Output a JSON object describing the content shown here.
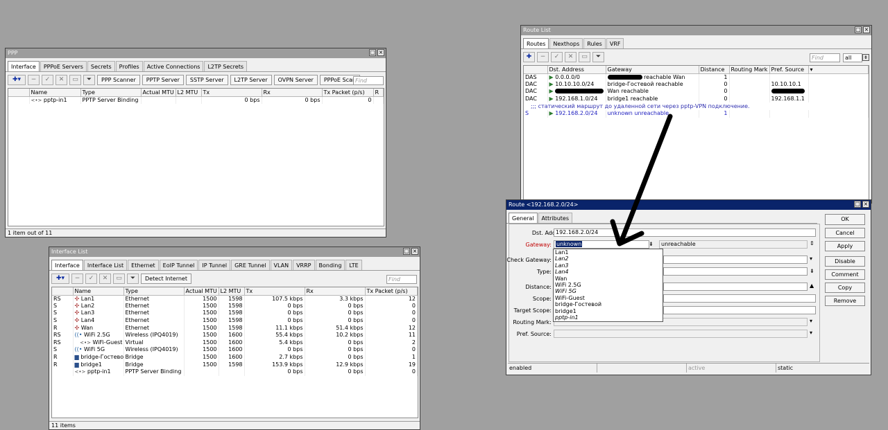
{
  "ppp": {
    "title": "PPP",
    "tabs": [
      "Interface",
      "PPPoE Servers",
      "Secrets",
      "Profiles",
      "Active Connections",
      "L2TP Secrets"
    ],
    "buttons": [
      "PPP Scanner",
      "PPTP Server",
      "SSTP Server",
      "L2TP Server",
      "OVPN Server",
      "PPPoE Scan"
    ],
    "find": "Find",
    "columns": [
      "Name",
      "Type",
      "Actual MTU",
      "L2 MTU",
      "Tx",
      "Rx",
      "Tx Packet (p/s)",
      "R"
    ],
    "rows": [
      {
        "flag": "",
        "name": "pptp-in1",
        "type": "PPTP Server Binding",
        "mtu": "",
        "l2mtu": "",
        "tx": "0 bps",
        "rx": "0 bps",
        "txp": "0"
      }
    ],
    "status": "1 item out of 11"
  },
  "iflist": {
    "title": "Interface List",
    "tabs": [
      "Interface",
      "Interface List",
      "Ethernet",
      "EoIP Tunnel",
      "IP Tunnel",
      "GRE Tunnel",
      "VLAN",
      "VRRP",
      "Bonding",
      "LTE"
    ],
    "detect_button": "Detect Internet",
    "find": "Find",
    "columns": [
      "Name",
      "Type",
      "Actual MTU",
      "L2 MTU",
      "Tx",
      "Rx",
      "Tx Packet (p/s)"
    ],
    "rows": [
      {
        "flag": "RS",
        "icon": "eth",
        "name": "Lan1",
        "type": "Ethernet",
        "mtu": "1500",
        "l2mtu": "1598",
        "tx": "107.5 kbps",
        "rx": "3.3 kbps",
        "txp": "12"
      },
      {
        "flag": "S",
        "icon": "eth",
        "name": "Lan2",
        "type": "Ethernet",
        "mtu": "1500",
        "l2mtu": "1598",
        "tx": "0 bps",
        "rx": "0 bps",
        "txp": "0"
      },
      {
        "flag": "S",
        "icon": "eth",
        "name": "Lan3",
        "type": "Ethernet",
        "mtu": "1500",
        "l2mtu": "1598",
        "tx": "0 bps",
        "rx": "0 bps",
        "txp": "0"
      },
      {
        "flag": "S",
        "icon": "eth",
        "name": "Lan4",
        "type": "Ethernet",
        "mtu": "1500",
        "l2mtu": "1598",
        "tx": "0 bps",
        "rx": "0 bps",
        "txp": "0"
      },
      {
        "flag": "R",
        "icon": "eth",
        "name": "Wan",
        "type": "Ethernet",
        "mtu": "1500",
        "l2mtu": "1598",
        "tx": "11.1 kbps",
        "rx": "51.4 kbps",
        "txp": "12"
      },
      {
        "flag": "RS",
        "icon": "wifi",
        "name": "WiFi 2.5G",
        "type": "Wireless (IPQ4019)",
        "mtu": "1500",
        "l2mtu": "1600",
        "tx": "55.4 kbps",
        "rx": "10.2 kbps",
        "txp": "11"
      },
      {
        "flag": "RS",
        "icon": "if",
        "name": "WiFi-Guest",
        "type": "Virtual",
        "mtu": "1500",
        "l2mtu": "1600",
        "tx": "5.4 kbps",
        "rx": "0 bps",
        "txp": "2",
        "indent": true
      },
      {
        "flag": "S",
        "icon": "wifi",
        "name": "WiFi 5G",
        "type": "Wireless (IPQ4019)",
        "mtu": "1500",
        "l2mtu": "1600",
        "tx": "0 bps",
        "rx": "0 bps",
        "txp": "0"
      },
      {
        "flag": "R",
        "icon": "br",
        "name": "bridge-Гостевой",
        "type": "Bridge",
        "mtu": "1500",
        "l2mtu": "1600",
        "tx": "2.7 kbps",
        "rx": "0 bps",
        "txp": "1"
      },
      {
        "flag": "R",
        "icon": "br",
        "name": "bridge1",
        "type": "Bridge",
        "mtu": "1500",
        "l2mtu": "1598",
        "tx": "153.9 kbps",
        "rx": "12.9 kbps",
        "txp": "19"
      },
      {
        "flag": "",
        "icon": "if",
        "name": "pptp-in1",
        "type": "PPTP Server Binding",
        "mtu": "",
        "l2mtu": "",
        "tx": "0 bps",
        "rx": "0 bps",
        "txp": "0"
      }
    ],
    "status": "11 items"
  },
  "routes": {
    "title": "Route List",
    "tabs": [
      "Routes",
      "Nexthops",
      "Rules",
      "VRF"
    ],
    "find": "Find",
    "filter": "all",
    "columns": [
      "Dst. Address",
      "Gateway",
      "Distance",
      "Routing Mark",
      "Pref. Source"
    ],
    "rows": [
      {
        "flag": "DAS",
        "dst": "0.0.0.0/0",
        "gw": "reachable Wan",
        "dist": "1",
        "mark": "",
        "pref": "",
        "gw_redact": true
      },
      {
        "flag": "DAC",
        "dst": "10.10.10.0/24",
        "gw": "bridge-Гостевой reachable",
        "dist": "0",
        "mark": "",
        "pref": "10.10.10.1"
      },
      {
        "flag": "DAC",
        "dst": "",
        "gw": "Wan reachable",
        "dist": "0",
        "mark": "",
        "pref": "",
        "dst_redact": true,
        "pref_redact": true
      },
      {
        "flag": "DAC",
        "dst": "192.168.1.0/24",
        "gw": "bridge1 reachable",
        "dist": "0",
        "mark": "",
        "pref": "192.168.1.1"
      }
    ],
    "comment": ";;; статический маршрут до удаленной сети через pptp-VPN подключение.",
    "static_row": {
      "flag": "S",
      "dst": "192.168.2.0/24",
      "gw": "unknown unreachable",
      "dist": "1",
      "mark": "",
      "pref": ""
    }
  },
  "route_dialog": {
    "title": "Route <192.168.2.0/24>",
    "tabs": [
      "General",
      "Attributes"
    ],
    "labels": {
      "dst": "Dst. Address:",
      "gateway": "Gateway:",
      "check_gateway": "Check Gateway:",
      "type": "Type:",
      "distance": "Distance:",
      "scope": "Scope:",
      "target_scope": "Target Scope:",
      "routing_mark": "Routing Mark:",
      "pref_source": "Pref. Source:"
    },
    "dst_value": "192.168.2.0/24",
    "gateway_value": "unknown",
    "gateway_state": "unreachable",
    "gateway_options": [
      {
        "label": "Lan1",
        "italic": false
      },
      {
        "label": "Lan2",
        "italic": true
      },
      {
        "label": "Lan3",
        "italic": true
      },
      {
        "label": "Lan4",
        "italic": true
      },
      {
        "label": "Wan",
        "italic": false
      },
      {
        "label": "WiFi 2.5G",
        "italic": false
      },
      {
        "label": "WiFi 5G",
        "italic": true
      },
      {
        "label": "WiFi-Guest",
        "italic": false
      },
      {
        "label": "bridge-Гостевой",
        "italic": false
      },
      {
        "label": "bridge1",
        "italic": false
      },
      {
        "label": "pptp-in1",
        "italic": true
      }
    ],
    "buttons": [
      "OK",
      "Cancel",
      "Apply",
      "Disable",
      "Comment",
      "Copy",
      "Remove"
    ],
    "status": [
      "enabled",
      "",
      "active",
      "static"
    ]
  }
}
